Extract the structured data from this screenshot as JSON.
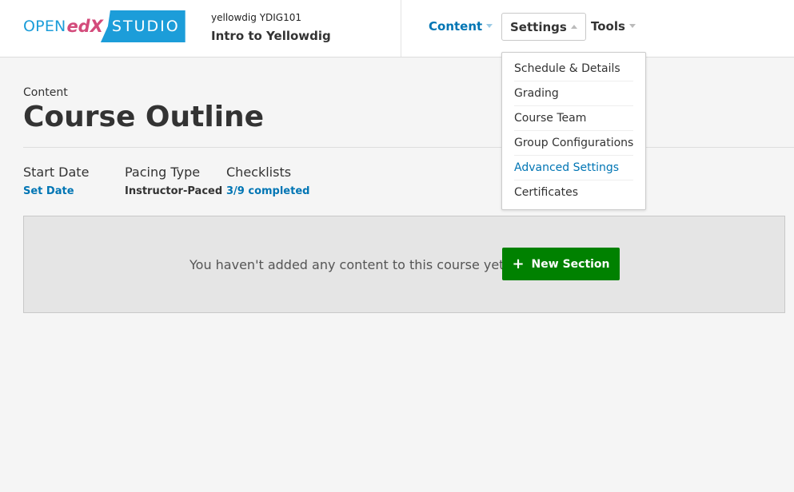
{
  "logo": {
    "open": "OPEN",
    "edx": "edX",
    "studio": "STUDIO"
  },
  "course": {
    "org": "yellowdig  YDIG101",
    "title": "Intro to Yellowdig"
  },
  "nav": {
    "content": "Content",
    "settings": "Settings",
    "tools": "Tools"
  },
  "settings_menu": {
    "items": [
      {
        "label": "Schedule & Details"
      },
      {
        "label": "Grading"
      },
      {
        "label": "Course Team"
      },
      {
        "label": "Group Configurations"
      },
      {
        "label": "Advanced Settings"
      },
      {
        "label": "Certificates"
      }
    ]
  },
  "page": {
    "section": "Content",
    "title": "Course Outline"
  },
  "status": {
    "start_date_label": "Start Date",
    "start_date_value": "Set Date",
    "pacing_label": "Pacing Type",
    "pacing_value": "Instructor-Paced",
    "checklists_label": "Checklists",
    "checklists_value": "3/9 completed"
  },
  "empty": {
    "message": "You haven't added any content to this course yet.",
    "button": "New Section",
    "icon": "plus-icon"
  },
  "colors": {
    "brand_blue": "#1c9dd9",
    "link_blue": "#0075b4",
    "button_green": "#008100",
    "edx_pink": "#d34b7b"
  }
}
